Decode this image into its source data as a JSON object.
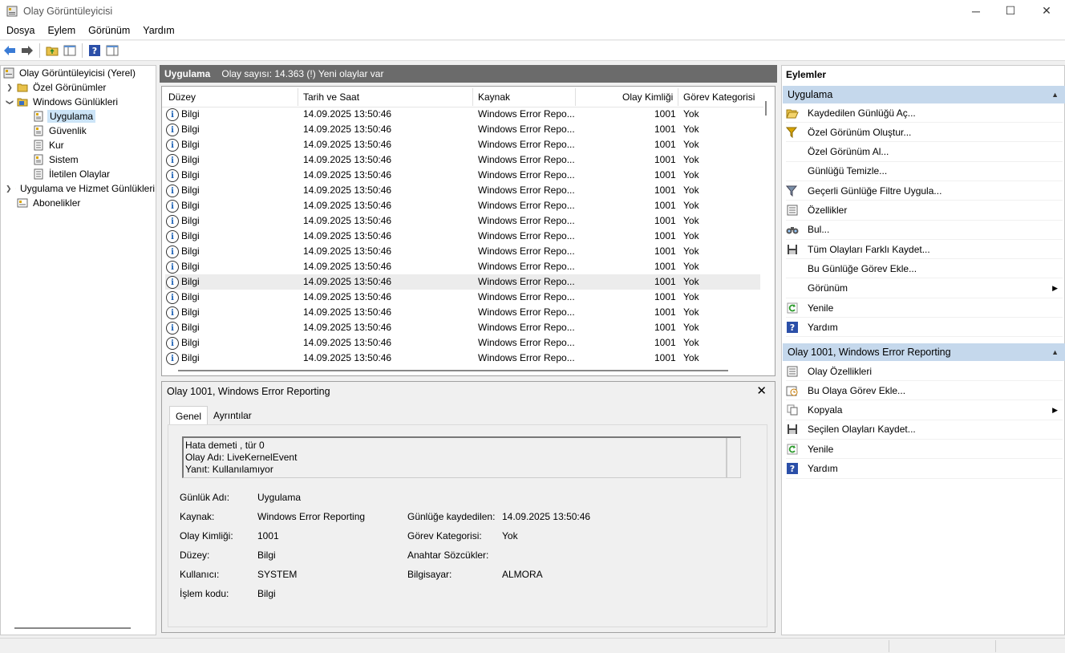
{
  "window": {
    "title": "Olay Görüntüleyicisi"
  },
  "menu": [
    "Dosya",
    "Eylem",
    "Görünüm",
    "Yardım"
  ],
  "tree": {
    "root": "Olay Görüntüleyicisi (Yerel)",
    "custom_views": "Özel Görünümler",
    "windows_logs": "Windows Günlükleri",
    "app": "Uygulama",
    "security": "Güvenlik",
    "setup": "Kur",
    "system": "Sistem",
    "forwarded": "İletilen Olaylar",
    "app_service": "Uygulama ve Hizmet Günlükleri",
    "subscriptions": "Abonelikler"
  },
  "center": {
    "log_name": "Uygulama",
    "event_count": "Olay sayısı: 14.363 (!) Yeni olaylar var"
  },
  "columns": {
    "level": "Düzey",
    "datetime": "Tarih ve Saat",
    "source": "Kaynak",
    "event_id": "Olay Kimliği",
    "task": "Görev Kategorisi"
  },
  "events": [
    {
      "level": "Bilgi",
      "datetime": "14.09.2025 13:50:46",
      "source": "Windows Error Repo...",
      "id": "1001",
      "task": "Yok"
    },
    {
      "level": "Bilgi",
      "datetime": "14.09.2025 13:50:46",
      "source": "Windows Error Repo...",
      "id": "1001",
      "task": "Yok"
    },
    {
      "level": "Bilgi",
      "datetime": "14.09.2025 13:50:46",
      "source": "Windows Error Repo...",
      "id": "1001",
      "task": "Yok"
    },
    {
      "level": "Bilgi",
      "datetime": "14.09.2025 13:50:46",
      "source": "Windows Error Repo...",
      "id": "1001",
      "task": "Yok"
    },
    {
      "level": "Bilgi",
      "datetime": "14.09.2025 13:50:46",
      "source": "Windows Error Repo...",
      "id": "1001",
      "task": "Yok"
    },
    {
      "level": "Bilgi",
      "datetime": "14.09.2025 13:50:46",
      "source": "Windows Error Repo...",
      "id": "1001",
      "task": "Yok"
    },
    {
      "level": "Bilgi",
      "datetime": "14.09.2025 13:50:46",
      "source": "Windows Error Repo...",
      "id": "1001",
      "task": "Yok"
    },
    {
      "level": "Bilgi",
      "datetime": "14.09.2025 13:50:46",
      "source": "Windows Error Repo...",
      "id": "1001",
      "task": "Yok"
    },
    {
      "level": "Bilgi",
      "datetime": "14.09.2025 13:50:46",
      "source": "Windows Error Repo...",
      "id": "1001",
      "task": "Yok"
    },
    {
      "level": "Bilgi",
      "datetime": "14.09.2025 13:50:46",
      "source": "Windows Error Repo...",
      "id": "1001",
      "task": "Yok"
    },
    {
      "level": "Bilgi",
      "datetime": "14.09.2025 13:50:46",
      "source": "Windows Error Repo...",
      "id": "1001",
      "task": "Yok"
    },
    {
      "level": "Bilgi",
      "datetime": "14.09.2025 13:50:46",
      "source": "Windows Error Repo...",
      "id": "1001",
      "task": "Yok"
    },
    {
      "level": "Bilgi",
      "datetime": "14.09.2025 13:50:46",
      "source": "Windows Error Repo...",
      "id": "1001",
      "task": "Yok"
    },
    {
      "level": "Bilgi",
      "datetime": "14.09.2025 13:50:46",
      "source": "Windows Error Repo...",
      "id": "1001",
      "task": "Yok"
    },
    {
      "level": "Bilgi",
      "datetime": "14.09.2025 13:50:46",
      "source": "Windows Error Repo...",
      "id": "1001",
      "task": "Yok"
    },
    {
      "level": "Bilgi",
      "datetime": "14.09.2025 13:50:46",
      "source": "Windows Error Repo...",
      "id": "1001",
      "task": "Yok"
    },
    {
      "level": "Bilgi",
      "datetime": "14.09.2025 13:50:46",
      "source": "Windows Error Repo...",
      "id": "1001",
      "task": "Yok"
    }
  ],
  "detail": {
    "title": "Olay 1001, Windows Error Reporting",
    "tab_general": "Genel",
    "tab_details": "Ayrıntılar",
    "message": [
      "Hata demeti , tür 0",
      "Olay Adı: LiveKernelEvent",
      "Yanıt: Kullanılamıyor"
    ],
    "labels": {
      "log_name": "Günlük Adı:",
      "source": "Kaynak:",
      "event_id": "Olay Kimliği:",
      "level": "Düzey:",
      "user": "Kullanıcı:",
      "opcode": "İşlem kodu:",
      "logged": "Günlüğe kaydedilen:",
      "task": "Görev Kategorisi:",
      "keywords": "Anahtar Sözcükler:",
      "computer": "Bilgisayar:"
    },
    "values": {
      "log_name": "Uygulama",
      "source": "Windows Error Reporting",
      "event_id": "1001",
      "level": "Bilgi",
      "user": "SYSTEM",
      "opcode": "Bilgi",
      "logged": "14.09.2025 13:50:46",
      "task": "Yok",
      "keywords": "",
      "computer": "ALMORA"
    }
  },
  "actions": {
    "title": "Eylemler",
    "section1": "Uygulama",
    "items1": [
      {
        "label": "Kaydedilen Günlüğü Aç...",
        "icon": "folder-open-icon"
      },
      {
        "label": "Özel Görünüm Oluştur...",
        "icon": "filter-create-icon"
      },
      {
        "label": "Özel Görünüm Al...",
        "icon": ""
      },
      {
        "label": "Günlüğü Temizle...",
        "icon": ""
      },
      {
        "label": "Geçerli Günlüğe Filtre Uygula...",
        "icon": "filter-icon"
      },
      {
        "label": "Özellikler",
        "icon": "properties-icon"
      },
      {
        "label": "Bul...",
        "icon": "binoculars-icon"
      },
      {
        "label": "Tüm Olayları Farklı Kaydet...",
        "icon": "save-icon"
      },
      {
        "label": "Bu Günlüğe Görev Ekle...",
        "icon": ""
      },
      {
        "label": "Görünüm",
        "icon": ""
      },
      {
        "label": "Yenile",
        "icon": "refresh-icon"
      },
      {
        "label": "Yardım",
        "icon": "help-icon"
      }
    ],
    "section2": "Olay 1001, Windows Error Reporting",
    "items2": [
      {
        "label": "Olay Özellikleri",
        "icon": "properties-icon"
      },
      {
        "label": "Bu Olaya Görev Ekle...",
        "icon": "task-icon"
      },
      {
        "label": "Kopyala",
        "icon": "copy-icon"
      },
      {
        "label": "Seçilen Olayları Kaydet...",
        "icon": "save-icon"
      },
      {
        "label": "Yenile",
        "icon": "refresh-icon"
      },
      {
        "label": "Yardım",
        "icon": "help-icon"
      }
    ]
  }
}
